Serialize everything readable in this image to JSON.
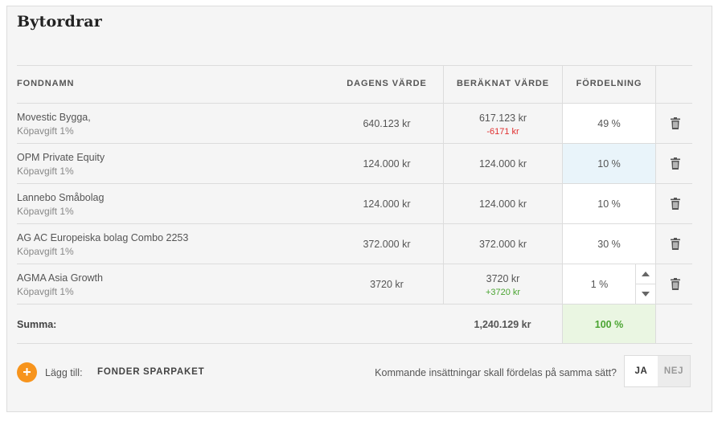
{
  "title": "Bytordrar",
  "headers": {
    "fund_name": "FONDNAMN",
    "todays_value": "DAGENS VÄRDE",
    "calculated_value": "BERÄKNAT VÄRDE",
    "distribution": "FÖRDELNING"
  },
  "rows": [
    {
      "name": "Movestic Bygga,",
      "fee": "Köpavgift 1%",
      "todays_value": "640.123 kr",
      "calculated_value": "617.123 kr",
      "diff": "-6171 kr",
      "distribution": "49 %"
    },
    {
      "name": "OPM Private Equity",
      "fee": "Köpavgift 1%",
      "todays_value": "124.000 kr",
      "calculated_value": "124.000 kr",
      "diff": "",
      "distribution": "10 %"
    },
    {
      "name": "Lannebo Småbolag",
      "fee": "Köpavgift 1%",
      "todays_value": "124.000 kr",
      "calculated_value": "124.000 kr",
      "diff": "",
      "distribution": "10 %"
    },
    {
      "name": "AG AC Europeiska bolag Combo 2253",
      "fee": "Köpavgift 1%",
      "todays_value": "372.000 kr",
      "calculated_value": "372.000 kr",
      "diff": "",
      "distribution": "30 %"
    },
    {
      "name": "AGMA Asia Growth",
      "fee": "Köpavgift 1%",
      "todays_value": "3720 kr",
      "calculated_value": "3720 kr",
      "diff": "+3720 kr",
      "distribution": "1 %"
    }
  ],
  "summary": {
    "label": "Summa:",
    "calculated_total": "1,240.129 kr",
    "distribution_total": "100 %"
  },
  "footer": {
    "add_icon": "+",
    "add_label": "Lägg till:",
    "add_funds": "FONDER",
    "add_packages": "SPARPAKET",
    "question": "Kommande insättningar skall fördelas på samma sätt?",
    "yes": "JA",
    "no": "NEJ"
  },
  "icons": {
    "delete": "trash-icon",
    "stepper_up": "chevron-up-icon",
    "stepper_down": "chevron-down-icon"
  },
  "colors": {
    "accent": "#f7941d",
    "negative": "#e03030",
    "positive": "#4aa431",
    "focus_bg": "#e9f4fa",
    "valid_bg": "#eaf6e2"
  }
}
